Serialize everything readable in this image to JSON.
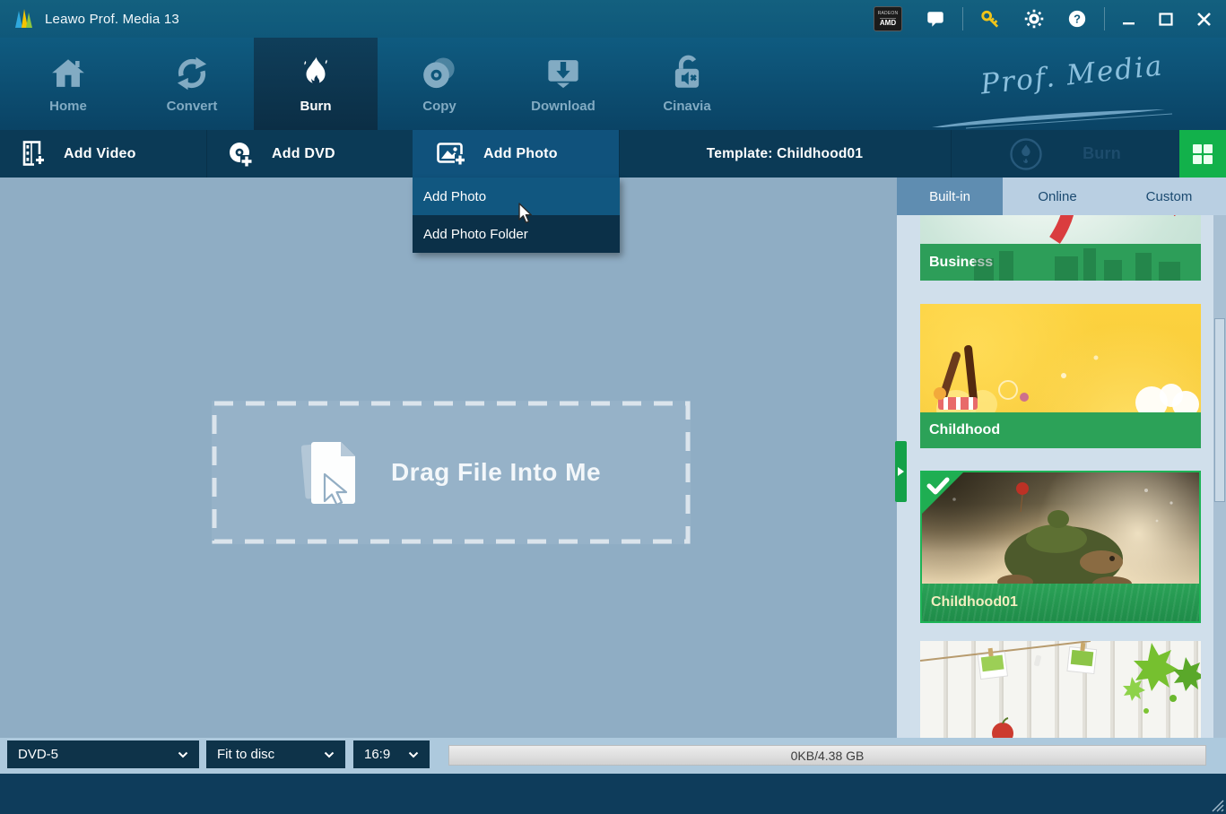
{
  "window": {
    "title": "Leawo Prof. Media 13",
    "amd_badge": {
      "line1": "RADEON",
      "line2": "AMD"
    },
    "titlebar_icons": [
      "amd-graphics-badge",
      "feedback-icon",
      "register-key-icon",
      "settings-gear-icon",
      "help-icon",
      "minimize-icon",
      "maximize-icon",
      "close-icon"
    ]
  },
  "nav": {
    "brand_script": "Prof. Media",
    "items": [
      {
        "label": "Home",
        "icon": "home-icon"
      },
      {
        "label": "Convert",
        "icon": "convert-icon"
      },
      {
        "label": "Burn",
        "icon": "flame-icon",
        "active": true
      },
      {
        "label": "Copy",
        "icon": "disc-copy-icon"
      },
      {
        "label": "Download",
        "icon": "download-icon"
      },
      {
        "label": "Cinavia",
        "icon": "unlock-mute-icon"
      }
    ]
  },
  "toolbar": {
    "add_video": "Add Video",
    "add_dvd": "Add DVD",
    "add_photo": "Add Photo",
    "template": "Template: Childhood01",
    "burn": "Burn",
    "icons": [
      "add-video-icon",
      "add-dvd-icon",
      "add-photo-icon",
      "burn-circle-icon",
      "green-grid-icon"
    ]
  },
  "dropdown": {
    "items": [
      {
        "label": "Add Photo",
        "highlighted": true
      },
      {
        "label": "Add Photo Folder"
      }
    ]
  },
  "main": {
    "drop_hint": "Drag File Into Me"
  },
  "panel": {
    "tabs": [
      {
        "label": "Built-in",
        "active": true
      },
      {
        "label": "Online"
      },
      {
        "label": "Custom"
      }
    ],
    "templates": [
      {
        "name": "Business"
      },
      {
        "name": "Childhood"
      },
      {
        "name": "Childhood01",
        "selected": true
      },
      {
        "name": ""
      }
    ]
  },
  "bottom": {
    "disc_type": "DVD-5",
    "fit_mode": "Fit to disc",
    "aspect_ratio": "16:9",
    "capacity": "0KB/4.38 GB"
  },
  "colors": {
    "titlebar_blue": "#0f587a",
    "toolbar_navy": "#0b3a56",
    "highlight_blue": "#115780",
    "accent_green": "#12b14b",
    "selection_green": "#1db355",
    "key_yellow": "#f0c419",
    "workspace_gray_blue": "#8fadc4"
  }
}
